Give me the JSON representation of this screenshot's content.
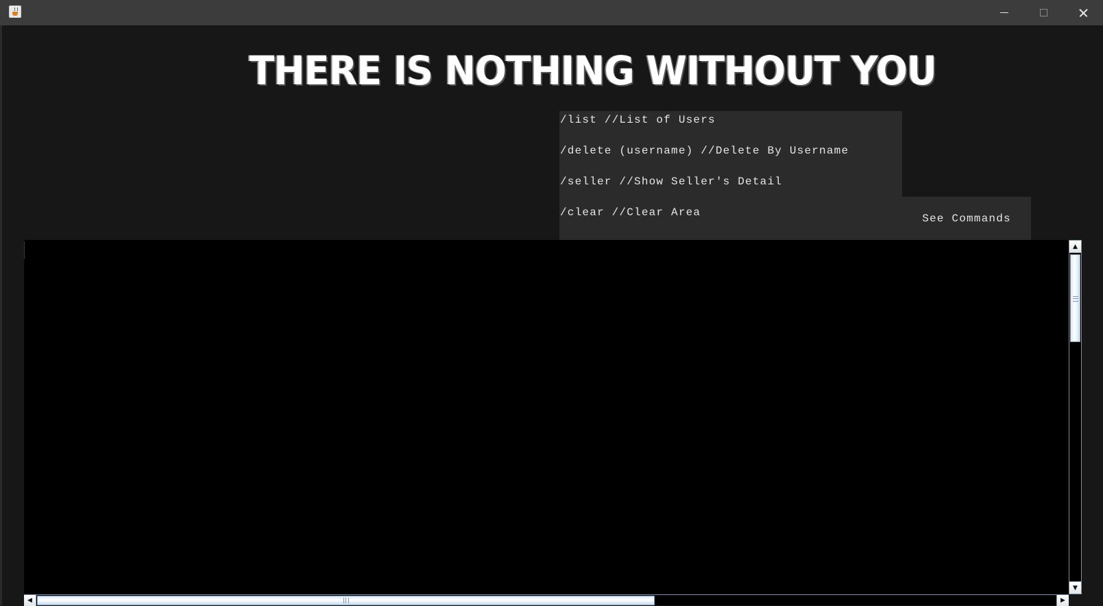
{
  "window": {
    "app_icon": "java-cup-icon",
    "controls": [
      "minimize-icon",
      "maximize-icon",
      "close-icon"
    ]
  },
  "heading": {
    "title": "THERE IS NOTHING WITHOUT YOU"
  },
  "commands": {
    "lines": [
      "/list //List of Users",
      "/delete (username) //Delete By Username",
      "/seller //Show Seller's Detail",
      "/clear //Clear Area"
    ],
    "toggle_label": "See Commands"
  },
  "output": {
    "text": ""
  },
  "colors": {
    "background": "#171717",
    "titlebar": "#3c3c3c",
    "panel": "#2b2b2b",
    "output": "#000000",
    "text": "#e6e6e6"
  }
}
